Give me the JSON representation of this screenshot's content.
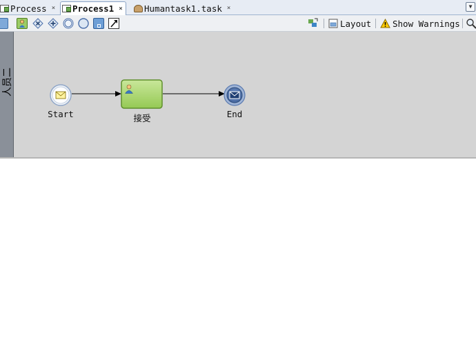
{
  "tabs": [
    {
      "label": "Process",
      "close": "×",
      "active": false
    },
    {
      "label": "Process1",
      "close": "×",
      "active": true
    },
    {
      "label": "Humantask1.task",
      "close": "×",
      "active": false
    }
  ],
  "toolbar": {
    "layout_label": "Layout",
    "warnings_label": "Show Warnings"
  },
  "lane": {
    "label": "人员二"
  },
  "diagram": {
    "start_label": "Start",
    "task_label": "接受",
    "end_label": "End"
  },
  "colors": {
    "canvas": "#d4d4d4",
    "lane_header": "#8a9099",
    "task_fill": "#a6d465",
    "task_border": "#5f8f2c",
    "event_blue": "#4a6ea9"
  }
}
